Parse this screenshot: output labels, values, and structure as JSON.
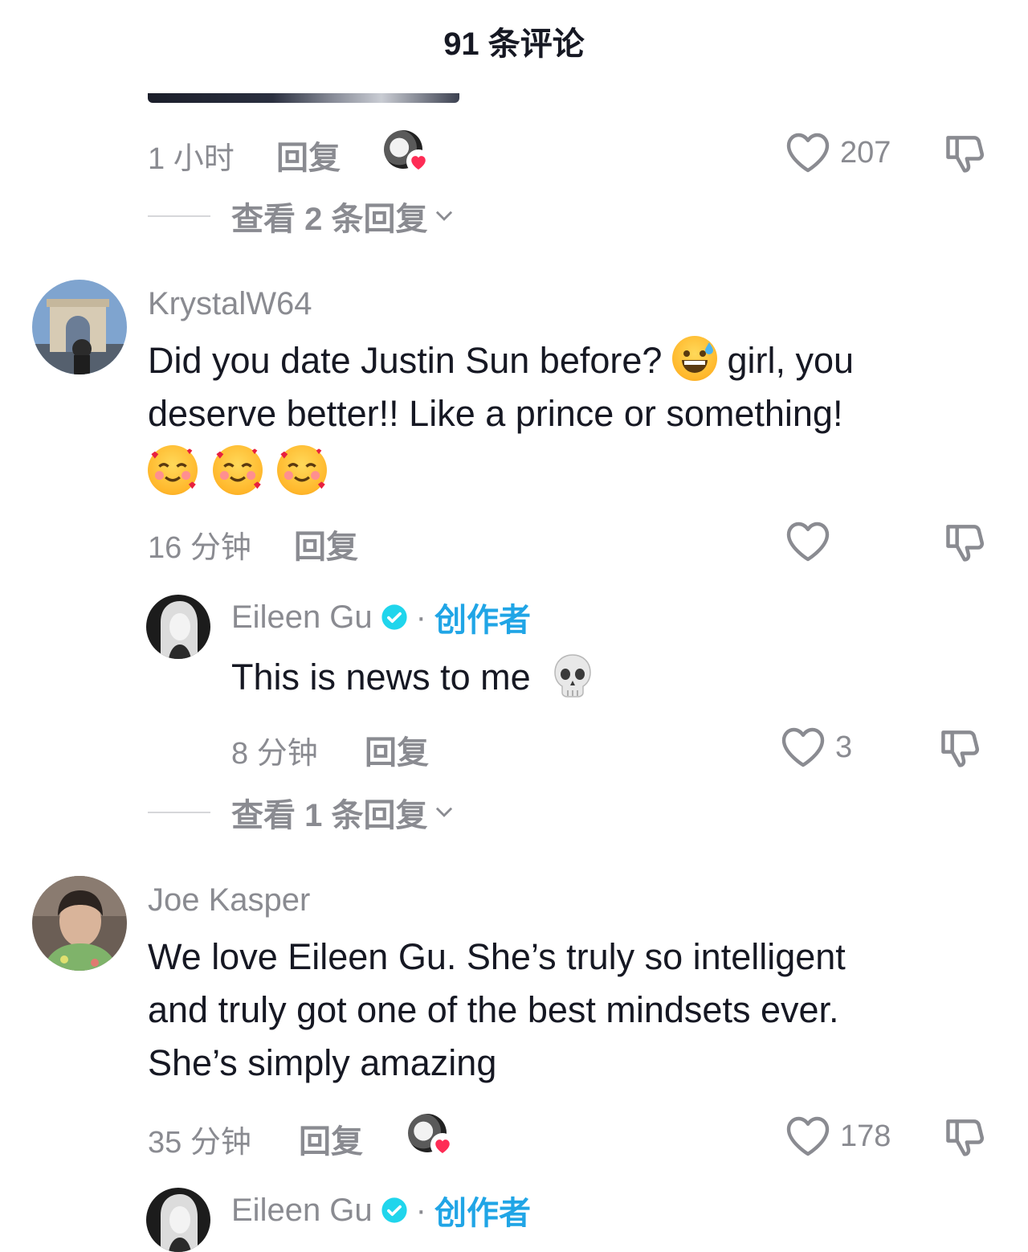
{
  "header": {
    "title": "91 条评论"
  },
  "top_comment_meta": {
    "time": "1 小时",
    "reply_label": "回复",
    "likes": "207",
    "view_replies": "查看 2 条回复"
  },
  "comments": [
    {
      "username": "KrystalW64",
      "text_line1": "Did you date Justin Sun before?",
      "text_line1_after": "girl, you",
      "text_line2": "deserve better!! Like a prince or something!",
      "time": "16 分钟",
      "reply_label": "回复",
      "likes": "",
      "reply": {
        "username": "Eileen Gu",
        "role": "创作者",
        "dot": "·",
        "text": "This is news to me",
        "time": "8 分钟",
        "reply_label": "回复",
        "likes": "3"
      },
      "view_replies": "查看 1 条回复"
    },
    {
      "username": "Joe Kasper",
      "text_line1": "We love Eileen Gu. She’s truly so intelligent",
      "text_line2": "and truly got one of the best mindsets ever.",
      "text_line3": "She’s simply amazing",
      "time": "35 分钟",
      "reply_label": "回复",
      "likes": "178",
      "reply": {
        "username": "Eileen Gu",
        "dot": "·",
        "role": "创作者"
      }
    }
  ],
  "icons": {
    "like": "heart-outline-icon",
    "dislike": "thumbs-down-icon",
    "verified": "verified-badge-icon",
    "chevron": "chevron-down-icon"
  },
  "colors": {
    "text_primary": "#161823",
    "text_secondary": "#8a8b91",
    "creator_blue": "#20a5e6",
    "heart_red": "#fe2c55"
  }
}
